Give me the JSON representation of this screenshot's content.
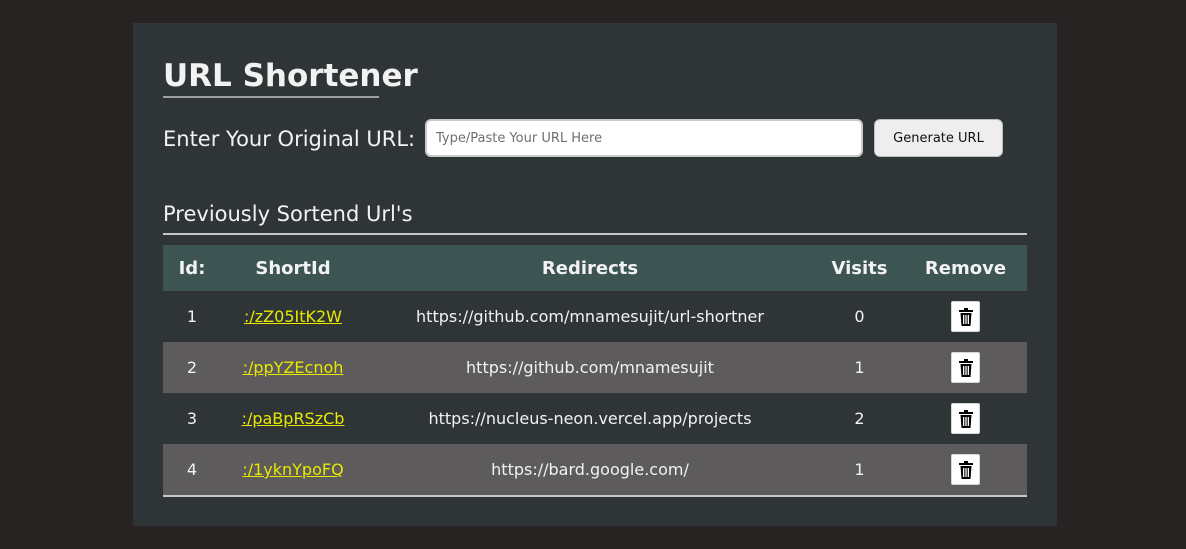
{
  "app": {
    "title": "URL Shortener"
  },
  "form": {
    "label": "Enter Your Original URL:",
    "input_value": "",
    "input_placeholder": "Type/Paste Your URL Here",
    "button_label": "Generate URL"
  },
  "history": {
    "title": "Previously Sortend Url's",
    "columns": [
      "Id:",
      "ShortId",
      "Redirects",
      "Visits",
      "Remove"
    ],
    "rows": [
      {
        "id": "1",
        "short_id": ":/zZ05ItK2W",
        "redirect": "https://github.com/mnamesujit/url-shortner",
        "visits": "0"
      },
      {
        "id": "2",
        "short_id": ":/ppYZEcnoh",
        "redirect": "https://github.com/mnamesujit",
        "visits": "1"
      },
      {
        "id": "3",
        "short_id": ":/paBpRSzCb",
        "redirect": "https://nucleus-neon.vercel.app/projects",
        "visits": "2"
      },
      {
        "id": "4",
        "short_id": ":/1yknYpoFQ",
        "redirect": "https://bard.google.com/",
        "visits": "1"
      }
    ],
    "remove_icon": "trash-icon"
  },
  "colors": {
    "page_background": "#272322",
    "card_background": "#2f3536",
    "table_header": "#3c5552",
    "striped_row": "#5d5b5b",
    "link": "#e8e800"
  }
}
